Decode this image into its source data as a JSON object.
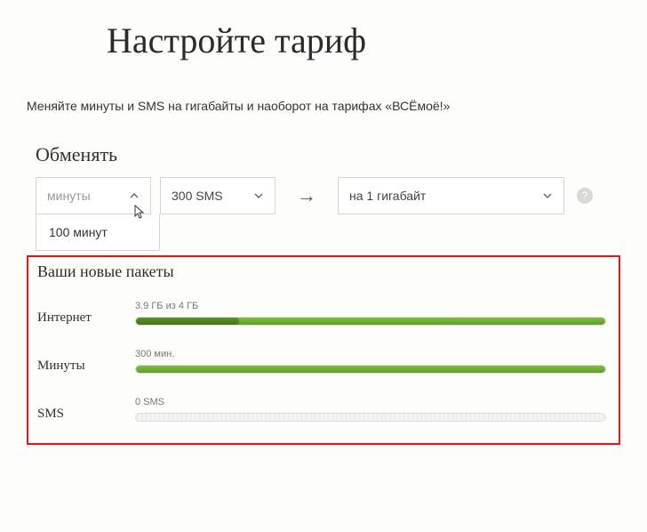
{
  "title": "Настройте тариф",
  "description": "Меняйте минуты и SMS на гигабайты и наоборот на тарифах «ВСЁмоё!»",
  "exchange": {
    "section_label": "Обменять",
    "from_placeholder": "минуты",
    "from_option_open": "100 минут",
    "sms_value": "300 SMS",
    "to_value": "на 1 гигабайт",
    "arrow": "→",
    "help": "?"
  },
  "packages": {
    "title": "Ваши новые пакеты",
    "internet": {
      "label": "Интернет",
      "caption": "3.9 ГБ из 4 ГБ",
      "fill_pct": 100,
      "used_dark_pct": 22
    },
    "minutes": {
      "label": "Минуты",
      "caption": "300 мин.",
      "fill_pct": 100
    },
    "sms": {
      "label": "SMS",
      "caption": "0 SMS",
      "fill_pct": 0
    }
  }
}
